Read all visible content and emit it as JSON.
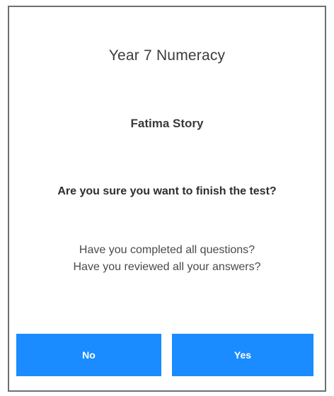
{
  "dialog": {
    "title": "Year 7 Numeracy",
    "student_name": "Fatima Story",
    "question": "Are you sure you want to finish the test?",
    "check_lines": [
      "Have you completed all questions?",
      "Have you reviewed all your answers?"
    ],
    "buttons": {
      "no_label": "No",
      "yes_label": "Yes"
    }
  },
  "colors": {
    "button_blue": "#1a8cff",
    "border": "#6f6f6f",
    "text": "#3c3c3c"
  }
}
